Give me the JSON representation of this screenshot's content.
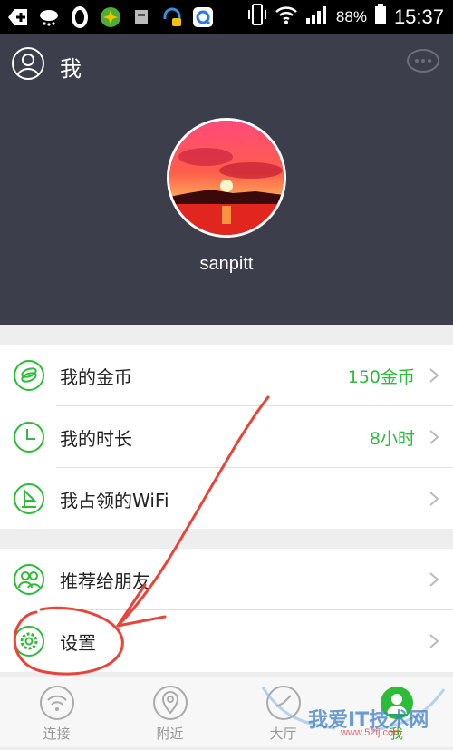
{
  "status_bar": {
    "battery_percent": "88%",
    "time": "15:37"
  },
  "header": {
    "title": "我",
    "username": "sanpitt"
  },
  "menu": {
    "coins": {
      "label": "我的金币",
      "value": "150金币"
    },
    "duration": {
      "label": "我的时长",
      "value": "8小时"
    },
    "wifi": {
      "label": "我占领的WiFi"
    },
    "recommend": {
      "label": "推荐给朋友"
    },
    "settings": {
      "label": "设置"
    }
  },
  "bottom_nav": {
    "tabs": [
      {
        "label": "连接",
        "icon": "wifi-icon"
      },
      {
        "label": "附近",
        "icon": "location-pin-icon"
      },
      {
        "label": "大厅",
        "icon": "hall-icon"
      },
      {
        "label": "我",
        "icon": "profile-icon",
        "active": true
      }
    ]
  },
  "watermark": {
    "text": "我爱IT技术网",
    "url": "www.52ij.com"
  },
  "colors": {
    "accent_green": "#2dbb3a",
    "header_bg": "#3d3e4b",
    "annotation_red": "#e8443a"
  }
}
